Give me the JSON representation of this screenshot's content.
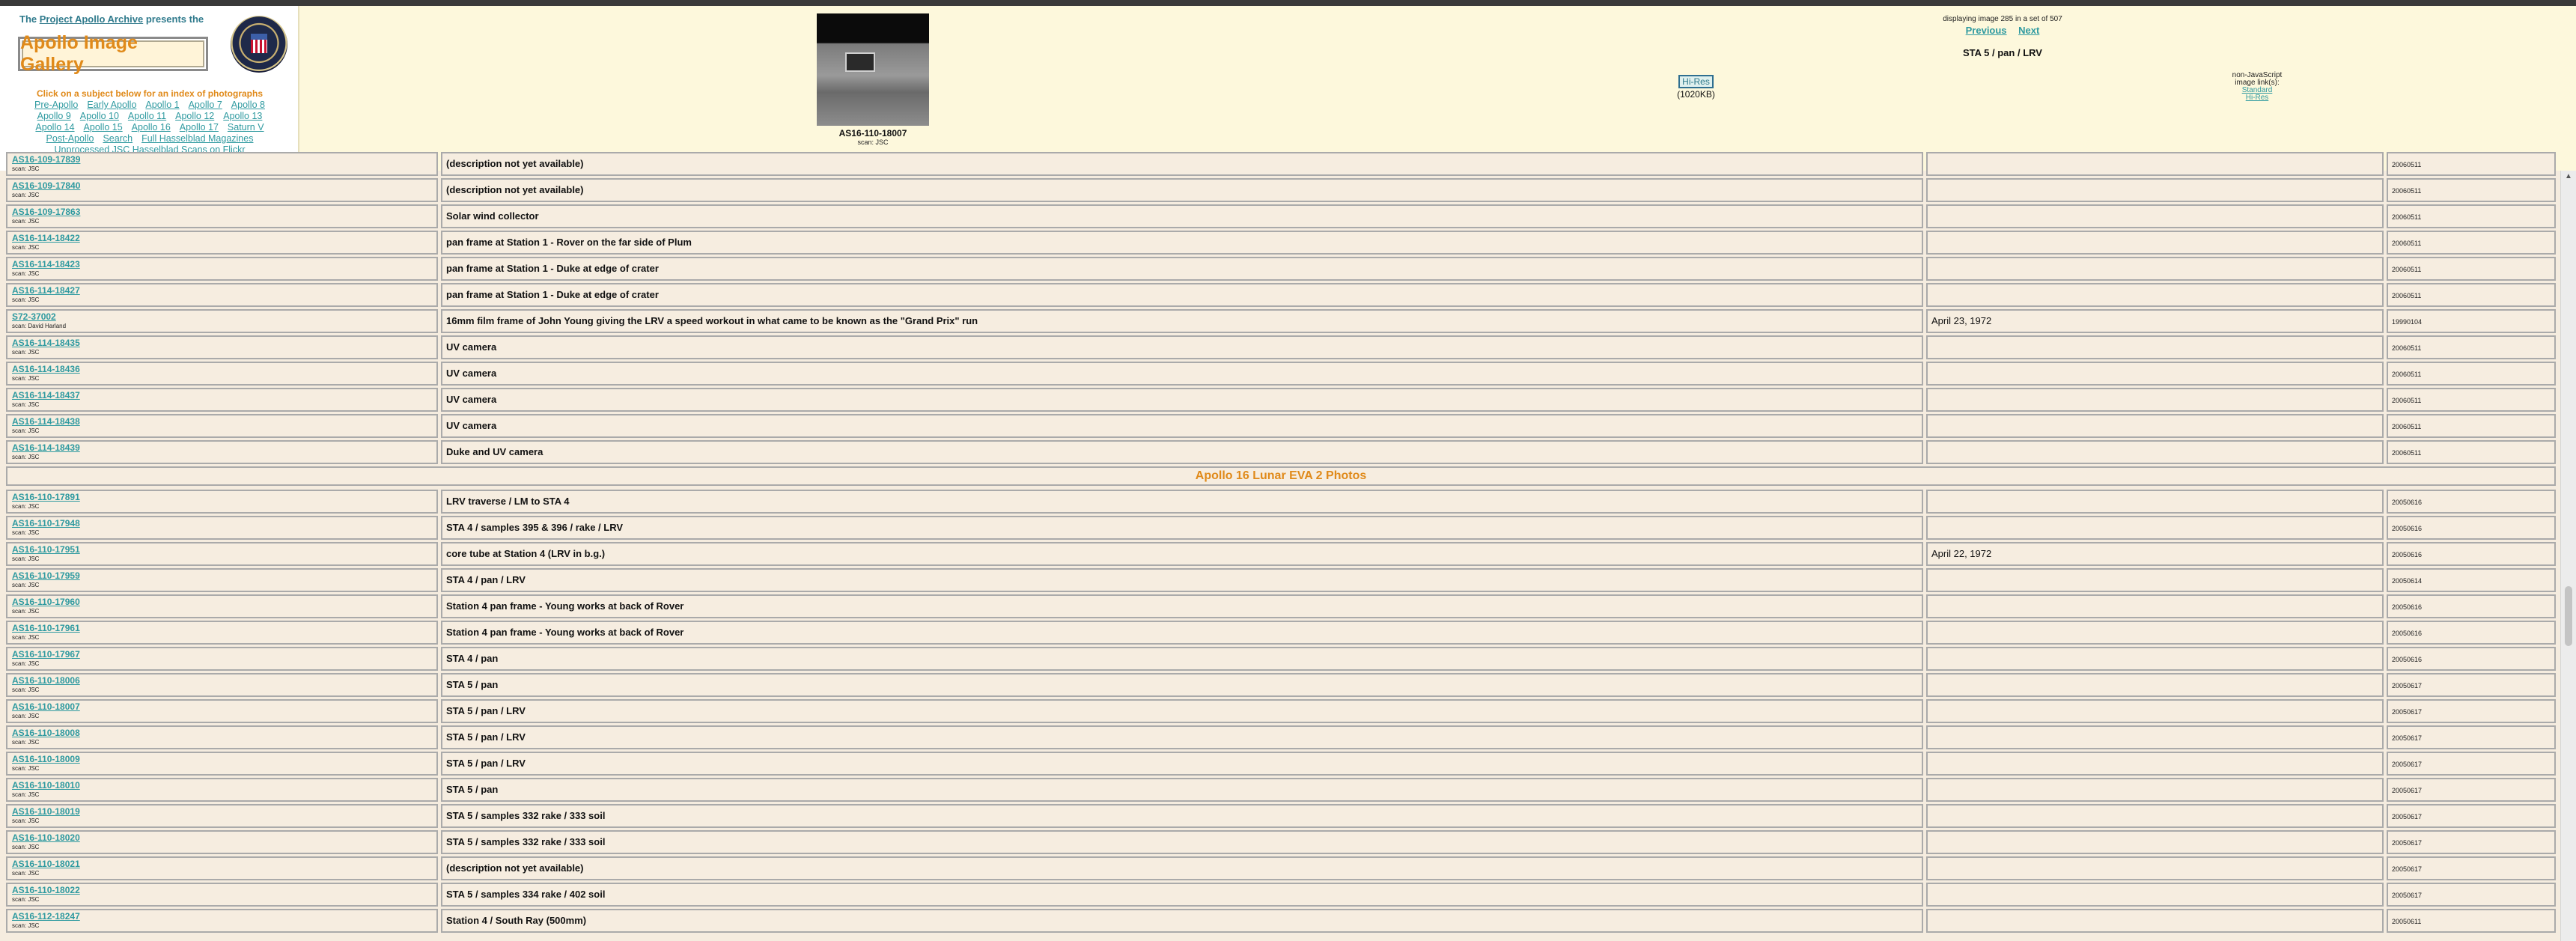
{
  "left_panel": {
    "presents_prefix": "The",
    "archive_link": "Project Apollo Archive",
    "presents_suffix": "presents the",
    "gallery_title": "Apollo Image Gallery",
    "click_text": "Click on a subject below for an index of photographs",
    "nav_lines": [
      [
        "Pre-Apollo",
        "Early Apollo",
        "Apollo 1",
        "Apollo 7",
        "Apollo 8"
      ],
      [
        "Apollo 9",
        "Apollo 10",
        "Apollo 11",
        "Apollo 12",
        "Apollo 13"
      ],
      [
        "Apollo 14",
        "Apollo 15",
        "Apollo 16",
        "Apollo 17",
        "Saturn V"
      ],
      [
        "Post-Apollo",
        "Search",
        "Full Hasselblad Magazines"
      ],
      [
        "Unprocessed JSC Hasselblad Scans on Flickr"
      ]
    ]
  },
  "thumbnail": {
    "caption": "AS16-110-18007",
    "scan": "scan: JSC"
  },
  "hires": {
    "label": "Hi-Res",
    "size": "(1020KB)"
  },
  "info": {
    "displaying": "displaying image 285 in a set of 507",
    "previous": "Previous",
    "next": "Next",
    "title": "STA 5 / pan / LRV"
  },
  "nonjs": {
    "line1": "non-JavaScript",
    "line2": "image link(s):",
    "standard": "Standard",
    "hires": "Hi-Res"
  },
  "rows": [
    {
      "id": "AS16-109-17839",
      "scan": "scan: JSC",
      "desc": "(description not yet available)",
      "date": "",
      "num": "20060511"
    },
    {
      "id": "AS16-109-17840",
      "scan": "scan: JSC",
      "desc": "(description not yet available)",
      "date": "",
      "num": "20060511"
    },
    {
      "id": "AS16-109-17863",
      "scan": "scan: JSC",
      "desc": "Solar wind collector",
      "date": "",
      "num": "20060511"
    },
    {
      "id": "AS16-114-18422",
      "scan": "scan: JSC",
      "desc": "pan frame at Station 1 - Rover on the far side of Plum",
      "date": "",
      "num": "20060511"
    },
    {
      "id": "AS16-114-18423",
      "scan": "scan: JSC",
      "desc": "pan frame at Station 1 - Duke at edge of crater",
      "date": "",
      "num": "20060511"
    },
    {
      "id": "AS16-114-18427",
      "scan": "scan: JSC",
      "desc": "pan frame at Station 1 - Duke at edge of crater",
      "date": "",
      "num": "20060511"
    },
    {
      "id": "S72-37002",
      "scan": "scan: David Harland",
      "desc": "16mm film frame of John Young giving the LRV a speed workout in what came to be known as the \"Grand Prix\" run",
      "date": "April 23, 1972",
      "num": "19990104"
    },
    {
      "id": "AS16-114-18435",
      "scan": "scan: JSC",
      "desc": "UV camera",
      "date": "",
      "num": "20060511"
    },
    {
      "id": "AS16-114-18436",
      "scan": "scan: JSC",
      "desc": "UV camera",
      "date": "",
      "num": "20060511"
    },
    {
      "id": "AS16-114-18437",
      "scan": "scan: JSC",
      "desc": "UV camera",
      "date": "",
      "num": "20060511"
    },
    {
      "id": "AS16-114-18438",
      "scan": "scan: JSC",
      "desc": "UV camera",
      "date": "",
      "num": "20060511"
    },
    {
      "id": "AS16-114-18439",
      "scan": "scan: JSC",
      "desc": "Duke and UV camera",
      "date": "",
      "num": "20060511"
    },
    {
      "section": "Apollo 16 Lunar EVA 2 Photos"
    },
    {
      "id": "AS16-110-17891",
      "scan": "scan: JSC",
      "desc": "LRV traverse / LM to STA 4",
      "date": "",
      "num": "20050616"
    },
    {
      "id": "AS16-110-17948",
      "scan": "scan: JSC",
      "desc": "STA 4 / samples 395 & 396 / rake / LRV",
      "date": "",
      "num": "20050616"
    },
    {
      "id": "AS16-110-17951",
      "scan": "scan: JSC",
      "desc": "core tube at Station 4 (LRV in b.g.)",
      "date": "April 22, 1972",
      "num": "20050616"
    },
    {
      "id": "AS16-110-17959",
      "scan": "scan: JSC",
      "desc": "STA 4 / pan / LRV",
      "date": "",
      "num": "20050614"
    },
    {
      "id": "AS16-110-17960",
      "scan": "scan: JSC",
      "desc": "Station 4 pan frame - Young works at back of Rover",
      "date": "",
      "num": "20050616"
    },
    {
      "id": "AS16-110-17961",
      "scan": "scan: JSC",
      "desc": "Station 4 pan frame - Young works at back of Rover",
      "date": "",
      "num": "20050616"
    },
    {
      "id": "AS16-110-17967",
      "scan": "scan: JSC",
      "desc": "STA 4 / pan",
      "date": "",
      "num": "20050616"
    },
    {
      "id": "AS16-110-18006",
      "scan": "scan: JSC",
      "desc": "STA 5 / pan",
      "date": "",
      "num": "20050617"
    },
    {
      "id": "AS16-110-18007",
      "scan": "scan: JSC",
      "desc": "STA 5 / pan / LRV",
      "date": "",
      "num": "20050617"
    },
    {
      "id": "AS16-110-18008",
      "scan": "scan: JSC",
      "desc": "STA 5 / pan / LRV",
      "date": "",
      "num": "20050617"
    },
    {
      "id": "AS16-110-18009",
      "scan": "scan: JSC",
      "desc": "STA 5 / pan / LRV",
      "date": "",
      "num": "20050617"
    },
    {
      "id": "AS16-110-18010",
      "scan": "scan: JSC",
      "desc": "STA 5 / pan",
      "date": "",
      "num": "20050617"
    },
    {
      "id": "AS16-110-18019",
      "scan": "scan: JSC",
      "desc": "STA 5 / samples 332 rake / 333 soil",
      "date": "",
      "num": "20050617"
    },
    {
      "id": "AS16-110-18020",
      "scan": "scan: JSC",
      "desc": "STA 5 / samples 332 rake / 333 soil",
      "date": "",
      "num": "20050617"
    },
    {
      "id": "AS16-110-18021",
      "scan": "scan: JSC",
      "desc": "(description not yet available)",
      "date": "",
      "num": "20050617"
    },
    {
      "id": "AS16-110-18022",
      "scan": "scan: JSC",
      "desc": "STA 5 / samples 334 rake / 402 soil",
      "date": "",
      "num": "20050617"
    },
    {
      "id": "AS16-112-18247",
      "scan": "scan: JSC",
      "desc": "Station 4 / South Ray (500mm)",
      "date": "",
      "num": "20050611"
    }
  ]
}
